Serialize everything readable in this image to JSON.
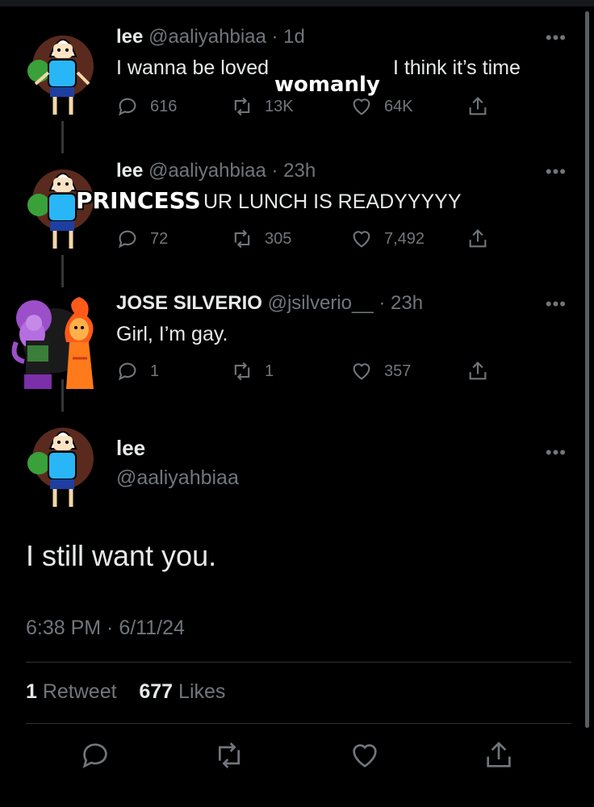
{
  "tweets": [
    {
      "name": "lee",
      "handle": "@aaliyahbiaa · 1d",
      "text": "I wanna be loved ",
      "text_after": "I think it’s time",
      "overlay": "womanly",
      "replies": "616",
      "retweets": "13K",
      "likes": "64K"
    },
    {
      "name": "lee",
      "handle": "@aaliyahbiaa · 23h",
      "text_after": "UR LUNCH IS READYYYYY",
      "overlay": "PRINCESS",
      "replies": "72",
      "retweets": "305",
      "likes": "7,492"
    },
    {
      "name": "JOSE SILVERIO",
      "handle": "@jsilverio__ · 23h",
      "text": "Girl, I’m gay.",
      "replies": "1",
      "retweets": "1",
      "likes": "357"
    }
  ],
  "main_tweet": {
    "name": "lee",
    "handle": "@aaliyahbiaa",
    "text": "I still want you.",
    "timestamp": "6:38 PM · 6/11/24",
    "retweet_count": "1",
    "retweet_label": " Retweet",
    "like_count": "677",
    "like_label": " Likes"
  },
  "icons": {
    "reply": "reply-icon",
    "retweet": "retweet-icon",
    "like": "heart-icon",
    "share": "share-icon",
    "more": "more-icon"
  },
  "colors": {
    "background": "#000000",
    "text": "#e7e9ea",
    "muted": "#71767b",
    "divider": "#2f3336"
  }
}
